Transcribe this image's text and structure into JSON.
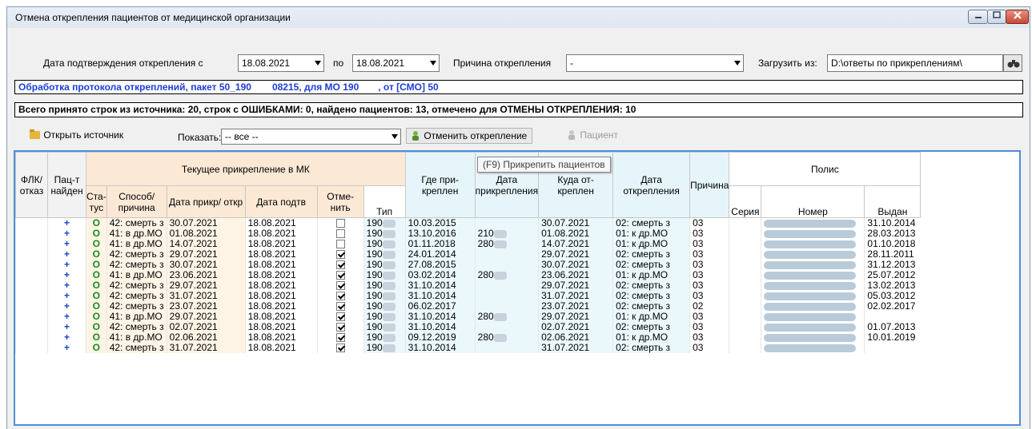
{
  "window": {
    "title": "Отмена открепления пациентов от медицинской организации"
  },
  "filters": {
    "date_from_label": "Дата подтверждения открепления с",
    "date_from": "18.08.2021",
    "date_to_label": "по",
    "date_to": "18.08.2021",
    "reason_label": "Причина открепления",
    "reason_value": "-",
    "load_label": "Загрузить из:",
    "load_path": "D:\\ответы по прикреплениям\\"
  },
  "protocol": {
    "part1": "Обработка протокола откреплений, пакет 50_190",
    "part2": "08215, для МО 190",
    "part3": ", от [СМО] 50"
  },
  "summary": "Всего принято строк из источника: 20, строк с ОШИБКАМИ: 0, найдено пациентов: 13, отмечено для ОТМЕНЫ ОТКРЕПЛЕНИЯ: 10",
  "toolbar": {
    "open_source": "Открыть источник",
    "show_label": "Показать:",
    "show_value": "-- все --",
    "cancel_detach": "Отменить открепление",
    "patient": "Пациент"
  },
  "tooltip": "(F9) Прикрепить пациентов",
  "columns": {
    "flk": "ФЛК/ отказ",
    "found": "Пац-т найден",
    "group_current": "Текущее прикрепление в МК",
    "status": "Ста- тус",
    "method": "Способ/ причина",
    "date_att": "Дата прикр/ откр",
    "date_confirm": "Дата подтв",
    "cancel": "Отме- нить",
    "where_att": "Где при- креплен",
    "date_attach": "Дата прикрепления",
    "where_det": "Куда от- креплен",
    "date_detach": "Дата открепления",
    "reason": "Причина",
    "policy": "Полис",
    "pol_type": "Тип",
    "pol_series": "Серия",
    "pol_number": "Номер",
    "pol_issued": "Выдан"
  },
  "rows": [
    {
      "found": "+",
      "status": "О",
      "method": "42: смерть з",
      "date_att": "30.07.2021",
      "date_confirm": "18.08.2021",
      "checked": false,
      "where_att": "190",
      "date_attach": "10.03.2015",
      "where_det": "",
      "date_detach": "30.07.2021",
      "reason": "02: смерть з",
      "pol_type": "03",
      "pol_issued": "31.10.2014"
    },
    {
      "found": "+",
      "status": "О",
      "method": "41: в др.МО",
      "date_att": "01.08.2021",
      "date_confirm": "18.08.2021",
      "checked": false,
      "where_att": "190",
      "date_attach": "13.10.2016",
      "where_det": "210",
      "date_detach": "01.08.2021",
      "reason": "01: к др.МО",
      "pol_type": "03",
      "pol_issued": "28.03.2013"
    },
    {
      "found": "+",
      "status": "О",
      "method": "41: в др.МО",
      "date_att": "14.07.2021",
      "date_confirm": "18.08.2021",
      "checked": false,
      "where_att": "190",
      "date_attach": "01.11.2018",
      "where_det": "280",
      "date_detach": "14.07.2021",
      "reason": "01: к др.МО",
      "pol_type": "03",
      "pol_issued": "01.10.2018"
    },
    {
      "found": "+",
      "status": "О",
      "method": "42: смерть з",
      "date_att": "29.07.2021",
      "date_confirm": "18.08.2021",
      "checked": true,
      "where_att": "190",
      "date_attach": "24.01.2014",
      "where_det": "",
      "date_detach": "29.07.2021",
      "reason": "02: смерть з",
      "pol_type": "03",
      "pol_issued": "28.11.2011"
    },
    {
      "found": "+",
      "status": "О",
      "method": "42: смерть з",
      "date_att": "30.07.2021",
      "date_confirm": "18.08.2021",
      "checked": true,
      "where_att": "190",
      "date_attach": "27.08.2015",
      "where_det": "",
      "date_detach": "30.07.2021",
      "reason": "02: смерть з",
      "pol_type": "03",
      "pol_issued": "31.12.2013"
    },
    {
      "found": "+",
      "status": "О",
      "method": "41: в др.МО",
      "date_att": "23.06.2021",
      "date_confirm": "18.08.2021",
      "checked": true,
      "where_att": "190",
      "date_attach": "03.02.2014",
      "where_det": "280",
      "date_detach": "23.06.2021",
      "reason": "01: к др.МО",
      "pol_type": "03",
      "pol_issued": "25.07.2012"
    },
    {
      "found": "+",
      "status": "О",
      "method": "42: смерть з",
      "date_att": "29.07.2021",
      "date_confirm": "18.08.2021",
      "checked": true,
      "where_att": "190",
      "date_attach": "31.10.2014",
      "where_det": "",
      "date_detach": "29.07.2021",
      "reason": "02: смерть з",
      "pol_type": "03",
      "pol_issued": "13.02.2013"
    },
    {
      "found": "+",
      "status": "О",
      "method": "42: смерть з",
      "date_att": "31.07.2021",
      "date_confirm": "18.08.2021",
      "checked": true,
      "where_att": "190",
      "date_attach": "31.10.2014",
      "where_det": "",
      "date_detach": "31.07.2021",
      "reason": "02: смерть з",
      "pol_type": "03",
      "pol_issued": "05.03.2012"
    },
    {
      "found": "+",
      "status": "О",
      "method": "42: смерть з",
      "date_att": "23.07.2021",
      "date_confirm": "18.08.2021",
      "checked": true,
      "where_att": "190",
      "date_attach": "06.02.2017",
      "where_det": "",
      "date_detach": "23.07.2021",
      "reason": "02: смерть з",
      "pol_type": "02",
      "pol_issued": "02.02.2017"
    },
    {
      "found": "+",
      "status": "О",
      "method": "41: в др.МО",
      "date_att": "29.07.2021",
      "date_confirm": "18.08.2021",
      "checked": true,
      "where_att": "190",
      "date_attach": "31.10.2014",
      "where_det": "280",
      "date_detach": "29.07.2021",
      "reason": "01: к др.МО",
      "pol_type": "03",
      "pol_issued": ""
    },
    {
      "found": "+",
      "status": "О",
      "method": "42: смерть з",
      "date_att": "02.07.2021",
      "date_confirm": "18.08.2021",
      "checked": true,
      "where_att": "190",
      "date_attach": "31.10.2014",
      "where_det": "",
      "date_detach": "02.07.2021",
      "reason": "02: смерть з",
      "pol_type": "03",
      "pol_issued": "01.07.2013"
    },
    {
      "found": "+",
      "status": "О",
      "method": "41: в др.МО",
      "date_att": "02.06.2021",
      "date_confirm": "18.08.2021",
      "checked": true,
      "where_att": "190",
      "date_attach": "09.12.2019",
      "where_det": "280",
      "date_detach": "02.06.2021",
      "reason": "01: к др.МО",
      "pol_type": "03",
      "pol_issued": "10.01.2019"
    },
    {
      "found": "+",
      "status": "О",
      "method": "42: смерть з",
      "date_att": "31.07.2021",
      "date_confirm": "18.08.2021",
      "checked": true,
      "where_att": "190",
      "date_attach": "31.10.2014",
      "where_det": "",
      "date_detach": "31.07.2021",
      "reason": "02: смерть з",
      "pol_type": "03",
      "pol_issued": ""
    }
  ]
}
